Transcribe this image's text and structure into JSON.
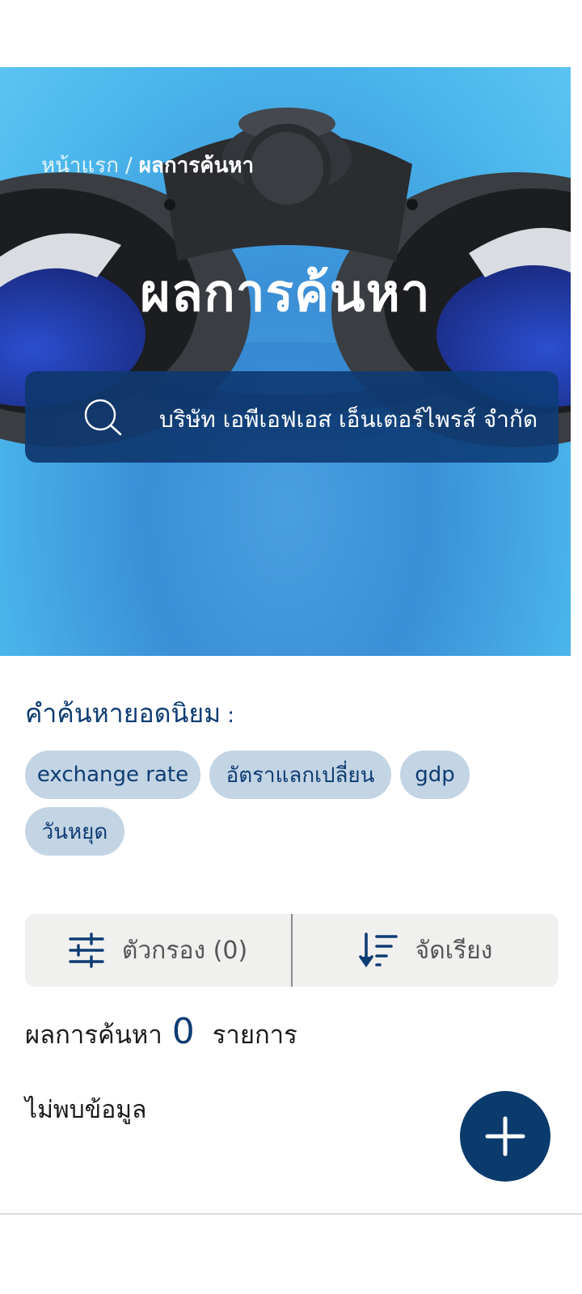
{
  "breadcrumb": {
    "home": "หน้าแรก",
    "separator": "/",
    "current": "ผลการค้นหา"
  },
  "hero": {
    "title": "ผลการค้นหา"
  },
  "search": {
    "icon": "search-icon",
    "value": "บริษัท เอพีเอฟเอส เอ็นเตอร์ไพรส์ จำกัด"
  },
  "popular": {
    "label": "คำค้นหายอดนิยม",
    "colon": ":",
    "chips": [
      "exchange rate",
      "อัตราแลกเปลี่ยน",
      "gdp",
      "วันหยุด"
    ]
  },
  "toolbar": {
    "filter_icon": "sliders-icon",
    "filter_label": "ตัวกรอง (0)",
    "sort_icon": "sort-descending-icon",
    "sort_label": "จัดเรียง"
  },
  "results": {
    "label": "ผลการค้นหา",
    "count": "0",
    "unit": "รายการ",
    "empty_message": "ไม่พบข้อมูล"
  },
  "fab": {
    "icon": "plus-icon"
  },
  "colors": {
    "primary": "#0b3a6d",
    "chip_bg": "#c3d4e4",
    "filter_bg": "#f0f0ee",
    "hero_sky": "#4ab6ec"
  }
}
